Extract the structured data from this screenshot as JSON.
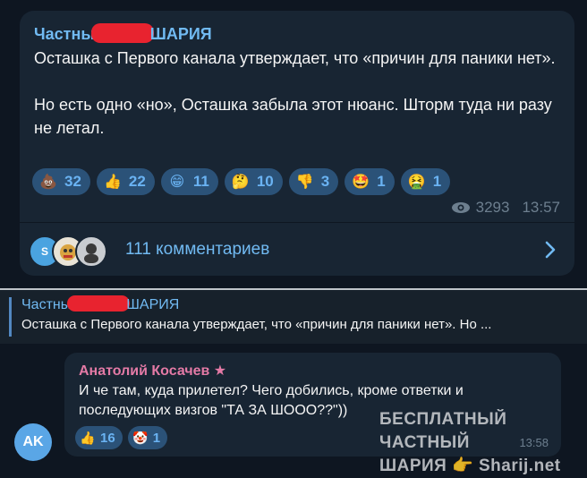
{
  "post": {
    "author": "Частны ШАРИЯ",
    "author_left": "Частны",
    "author_right": "ШАРИЯ",
    "paragraph1": "Осташка с Первого канала утверждает, что «причин для паники нет».",
    "paragraph2": "Но есть одно «но», Осташка забыла этот нюанс. Шторм туда ни разу не летал.",
    "reactions": [
      {
        "emoji": "💩",
        "count": "32",
        "icon": "poop-icon",
        "bg": "#6b4a2b"
      },
      {
        "emoji": "👍",
        "count": "22",
        "icon": "thumbs-up-icon",
        "bg": "#f2b233"
      },
      {
        "emoji": "😁",
        "count": "11",
        "icon": "grin-icon",
        "bg": "#f2c230"
      },
      {
        "emoji": "🤔",
        "count": "10",
        "icon": "thinking-icon",
        "bg": "#f2c230"
      },
      {
        "emoji": "👎",
        "count": "3",
        "icon": "thumbs-down-icon",
        "bg": "#f2b233"
      },
      {
        "emoji": "🤩",
        "count": "1",
        "icon": "star-struck-icon",
        "bg": "#f2c230"
      },
      {
        "emoji": "🤮",
        "count": "1",
        "icon": "vomit-icon",
        "bg": "#6cc04a"
      }
    ],
    "views": "3293",
    "time": "13:57",
    "comments_label": "111 комментариев",
    "commenter_avatar_1": "S"
  },
  "quote": {
    "author_left": "Частны",
    "author_right": "ШАРИЯ",
    "text": "Осташка с Первого канала утверждает, что «причин для паники нет».   Но ..."
  },
  "reply": {
    "author": "Анатолий Косачев ★",
    "text": "И че там, куда прилетел? Чего добились, кроме ответки и последующих визгов \"ТА ЗА ШООО??\"))",
    "reactions": [
      {
        "emoji": "👍",
        "count": "16",
        "icon": "thumbs-up-icon"
      },
      {
        "emoji": "🤡",
        "count": "1",
        "icon": "clown-icon"
      }
    ],
    "time": "13:58"
  },
  "user_avatar_initials": "AK",
  "watermark": {
    "line1": "БЕСПЛАТНЫЙ ЧАСТНЫЙ",
    "line2": "ШАРИЯ 👉 Sharij.net"
  },
  "colors": {
    "background": "#0e1621",
    "bubble": "#182533",
    "accent": "#71baf2",
    "reaction_bg": "#2b5278",
    "redaction": "#e8232f"
  }
}
